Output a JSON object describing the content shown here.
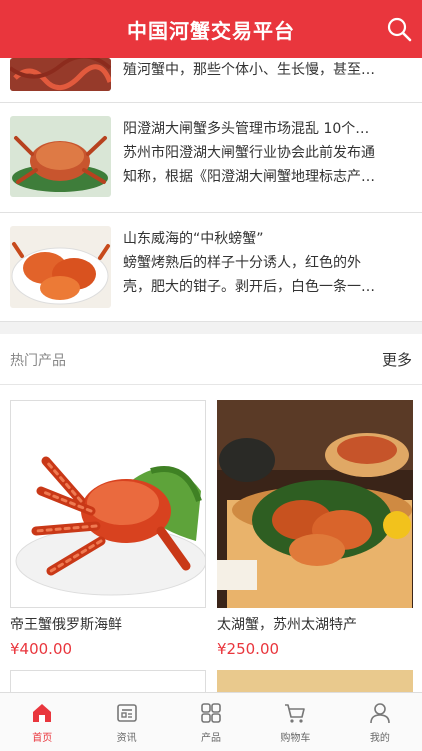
{
  "header": {
    "title": "中国河蟹交易平台",
    "search_icon": "search-icon"
  },
  "news": [
    {
      "lines": [
        "殖河蟹中，那些个体小、生长慢，甚至…"
      ]
    },
    {
      "lines": [
        "阳澄湖大闸蟹多头管理市场混乱 10个…",
        "苏州市阳澄湖大闸蟹行业协会此前发布通",
        "知称，根据《阳澄湖大闸蟹地理标志产…"
      ]
    },
    {
      "lines": [
        "山东威海的“中秋螃蟹”",
        "螃蟹烤熟后的样子十分诱人，红色的外",
        "壳，肥大的钳子。剥开后，白色一条一…"
      ]
    }
  ],
  "hot": {
    "title": "热门产品",
    "more": "更多"
  },
  "products": [
    {
      "name": "帝王蟹俄罗斯海鲜",
      "price": "¥400.00"
    },
    {
      "name": "太湖蟹，苏州太湖特产",
      "price": "¥250.00"
    }
  ],
  "tabs": [
    {
      "label": "首页",
      "icon": "home-icon",
      "active": true
    },
    {
      "label": "资讯",
      "icon": "news-icon",
      "active": false
    },
    {
      "label": "产品",
      "icon": "grid-icon",
      "active": false
    },
    {
      "label": "购物车",
      "icon": "cart-icon",
      "active": false
    },
    {
      "label": "我的",
      "icon": "user-icon",
      "active": false
    }
  ],
  "colors": {
    "brand": "#e9363d"
  }
}
